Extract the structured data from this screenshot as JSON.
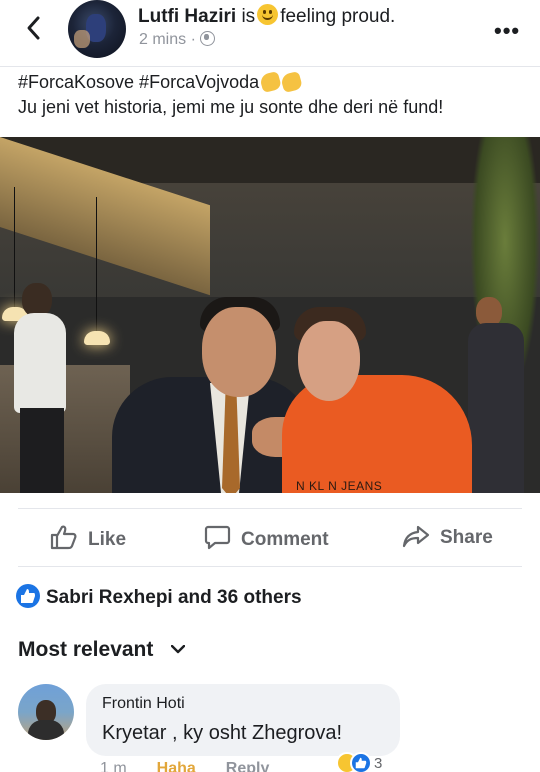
{
  "post": {
    "author": "Lutfi Haziri",
    "status_prefix": "is",
    "feeling": "feeling proud.",
    "time": "2 mins",
    "privacy_icon": "globe-icon",
    "hashtags": "#ForcaKosove #ForcaVojvoda",
    "text": "Ju jeni vet historia, jemi me ju sonte dhe deri në fund!",
    "photo_text": "N KL  N JEANS"
  },
  "actions": {
    "like": "Like",
    "comment": "Comment",
    "share": "Share"
  },
  "reactions": {
    "summary": "Sabri Rexhepi and 36 others"
  },
  "comments_header": {
    "label": "Most relevant"
  },
  "comment": {
    "author": "Frontin Hoti",
    "text": "Kryetar , ky osht Zhegrova!",
    "reaction_count": "3",
    "time": "1 m",
    "haha": "Haha",
    "reply": "Reply"
  },
  "colors": {
    "accent_blue": "#1b74e4",
    "hoodie_orange": "#ea5b22",
    "haha_yellow": "#e2a73b"
  }
}
